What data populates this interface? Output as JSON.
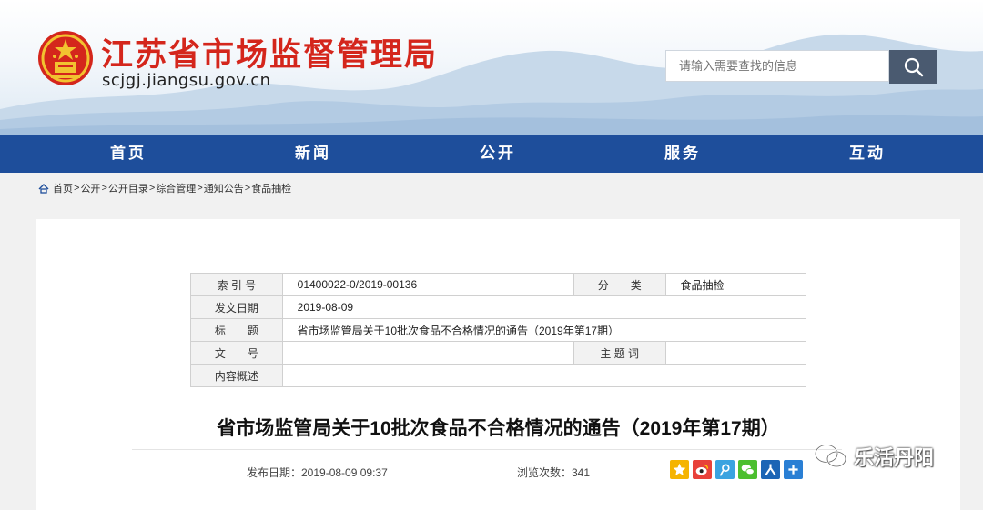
{
  "header": {
    "title": "江苏省市场监督管理局",
    "domain": "scjgj.jiangsu.gov.cn",
    "search_placeholder": "请输入需要查找的信息"
  },
  "nav": {
    "items": [
      "首页",
      "新闻",
      "公开",
      "服务",
      "互动"
    ]
  },
  "breadcrumb": [
    "首页",
    "公开",
    "公开目录",
    "综合管理",
    "通知公告",
    "食品抽检"
  ],
  "breadcrumb_sep": ">",
  "info_table": {
    "index_label": "索 引 号",
    "index_value": "01400022-0/2019-00136",
    "category_label": "分　　类",
    "category_value": "食品抽检",
    "date_label": "发文日期",
    "date_value": "2019-08-09",
    "title_label": "标　　题",
    "title_value": "省市场监管局关于10批次食品不合格情况的通告（2019年第17期）",
    "docno_label": "文　　号",
    "docno_value": "",
    "keywords_label": "主 题 词",
    "keywords_value": "",
    "summary_label": "内容概述",
    "summary_value": ""
  },
  "article": {
    "title": "省市场监管局关于10批次食品不合格情况的通告（2019年第17期）",
    "published": "发布日期：2019-08-09 09:37",
    "views": "浏览次数：341"
  },
  "share_icons": [
    "qzone-icon",
    "weibo-icon",
    "tencent-weibo-icon",
    "wechat-icon",
    "renren-icon",
    "more-share-icon"
  ],
  "watermark": "乐活丹阳",
  "colors": {
    "title_red": "#d4261c",
    "nav_blue": "#1e4e9b",
    "search_button": "#4a5a70"
  }
}
